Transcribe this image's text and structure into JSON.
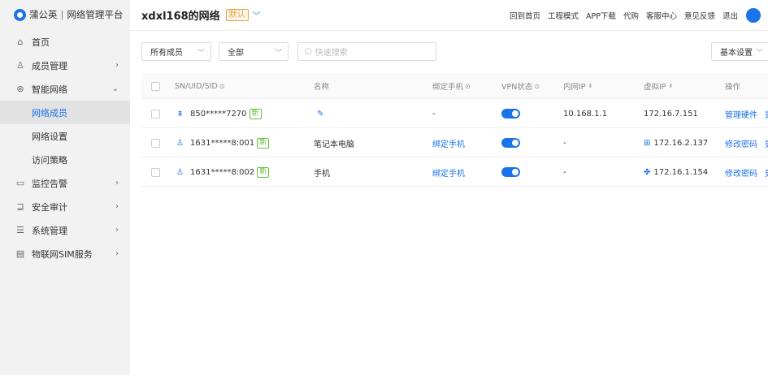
{
  "brand": {
    "name": "蒲公英",
    "product": "网络管理平台"
  },
  "sidebar": {
    "items": [
      {
        "label": "首页",
        "icon": "home-icon"
      },
      {
        "label": "成员管理",
        "icon": "user-icon",
        "arrow": "›"
      },
      {
        "label": "智能网络",
        "icon": "network-icon",
        "arrow": "⌄"
      },
      {
        "label": "监控告警",
        "icon": "monitor-icon",
        "arrow": "›"
      },
      {
        "label": "安全审计",
        "icon": "audit-icon",
        "arrow": "›"
      },
      {
        "label": "系统管理",
        "icon": "settings-icon",
        "arrow": "›"
      },
      {
        "label": "物联网SIM服务",
        "icon": "sim-icon",
        "arrow": "›"
      }
    ],
    "sub_items": [
      {
        "label": "网络成员",
        "active": true
      },
      {
        "label": "网络设置",
        "active": false
      },
      {
        "label": "访问策略",
        "active": false
      }
    ]
  },
  "header": {
    "network_name": "xdxl168的网络",
    "badge": "默认",
    "nav": [
      "回到首页",
      "工程模式",
      "APP下载",
      "代购",
      "客服中心",
      "意见反馈",
      "退出"
    ]
  },
  "toolbar": {
    "member_filter": "所有成员",
    "status_filter": "全部",
    "search_placeholder": "快速搜索",
    "view_mode": "基本设置"
  },
  "table": {
    "columns": [
      "SN/UID/SID",
      "名称",
      "绑定手机",
      "VPN状态",
      "内网IP",
      "虚拟IP",
      "操作"
    ],
    "rows": [
      {
        "id": "850*****7270",
        "tag": "新",
        "device": "router-icon",
        "name": "✎",
        "phone": "-",
        "vpn": true,
        "lan_ip": "10.168.1.1",
        "os": "",
        "virtual_ip": "172.16.7.151",
        "actions": [
          "管理硬件",
          "更"
        ]
      },
      {
        "id": "1631*****8:001",
        "tag": "新",
        "device": "user-icon",
        "name": "笔记本电脑",
        "phone": "绑定手机",
        "vpn": true,
        "lan_ip": "-",
        "os": "windows-icon",
        "virtual_ip": "172.16.2.137",
        "actions": [
          "修改密码",
          "更"
        ]
      },
      {
        "id": "1631*****8:002",
        "tag": "新",
        "device": "user-icon",
        "name": "手机",
        "phone": "绑定手机",
        "vpn": true,
        "lan_ip": "-",
        "os": "android-icon",
        "virtual_ip": "172.16.1.154",
        "actions": [
          "修改密码",
          "更"
        ]
      }
    ]
  },
  "colors": {
    "accent": "#1a73e8",
    "badge": "#e6a23c",
    "tag": "#67c23a"
  }
}
